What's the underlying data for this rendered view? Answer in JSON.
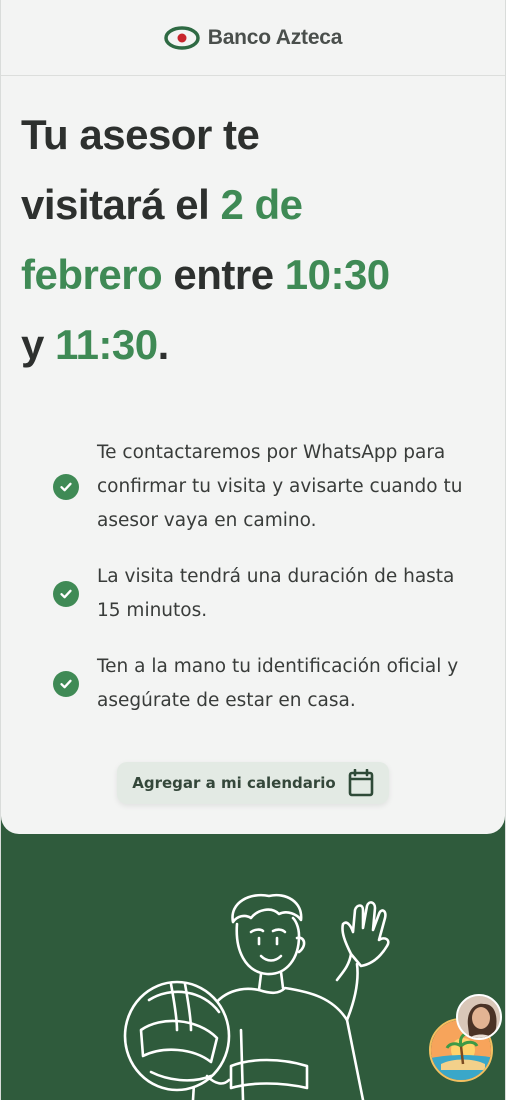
{
  "header": {
    "brand": "Banco Azteca",
    "logo_icon": "banco-azteca-logo-icon"
  },
  "title": {
    "line1": "Tu asesor te",
    "line2_pre": "visitará el ",
    "line2_hl": "2 de",
    "line3_hl": "febrero",
    "line3_mid": " entre ",
    "line3_hl2": "10:30",
    "line4_pre": "y ",
    "line4_hl": "11:30",
    "line4_post": "."
  },
  "items": [
    {
      "text": "Te contactaremos por WhatsApp para confirmar tu visita y avisarte cuando tu asesor vaya en camino.",
      "icon": "check-circle-icon"
    },
    {
      "text": "La visita tendrá una duración de hasta 15 minutos.",
      "icon": "check-circle-icon"
    },
    {
      "text": "Ten a la mano tu identificación oficial y asegúrate de estar en casa.",
      "icon": "check-circle-icon"
    }
  ],
  "calendar_button": {
    "label": "Agregar a mi calendario",
    "icon": "calendar-icon"
  },
  "colors": {
    "accent": "#3f8a55",
    "background_green": "#2f5b3c",
    "card": "#f3f4f3",
    "text": "#2d302e"
  }
}
